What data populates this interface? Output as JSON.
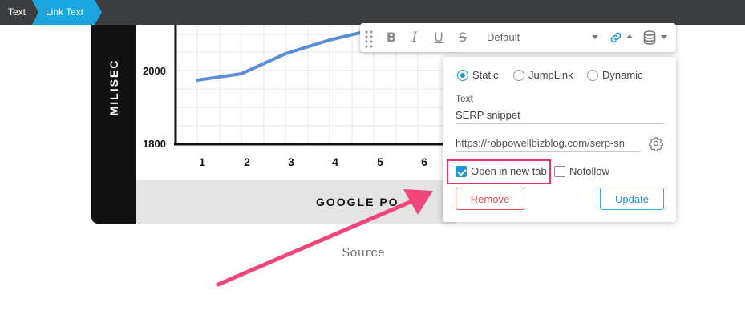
{
  "breadcrumb": {
    "items": [
      "Text",
      "Link Text"
    ],
    "colors": {
      "bar": "#3d3e40",
      "active": "#1aa7e0"
    }
  },
  "chart_image": {
    "y_axis_title": "MILISEC",
    "y_ticks": [
      "2000",
      "1800"
    ],
    "x_ticks": [
      "1",
      "2",
      "3",
      "4",
      "5",
      "6"
    ],
    "x_axis_title": "GOOGLE PO",
    "line_color": "#5b8ed8"
  },
  "caption": "Source",
  "toolbar": {
    "bold": "B",
    "italic": "I",
    "underline": "U",
    "strike": "S",
    "style_value": "Default",
    "icons": [
      "drag-handle-icon",
      "link-icon",
      "database-icon"
    ]
  },
  "link_popover": {
    "modes": [
      {
        "label": "Static",
        "selected": true
      },
      {
        "label": "JumpLink",
        "selected": false
      },
      {
        "label": "Dynamic",
        "selected": false
      }
    ],
    "text_label": "Text",
    "text_value": "SERP snippet",
    "url_value": "https://robpowellbizblog.com/serp-sn",
    "options": [
      {
        "label": "Open in new tab",
        "checked": true
      },
      {
        "label": "Nofollow",
        "checked": false
      }
    ],
    "remove_label": "Remove",
    "update_label": "Update",
    "colors": {
      "accent": "#2196d3",
      "remove": "#d9534f",
      "highlight": "#e8336d"
    }
  }
}
